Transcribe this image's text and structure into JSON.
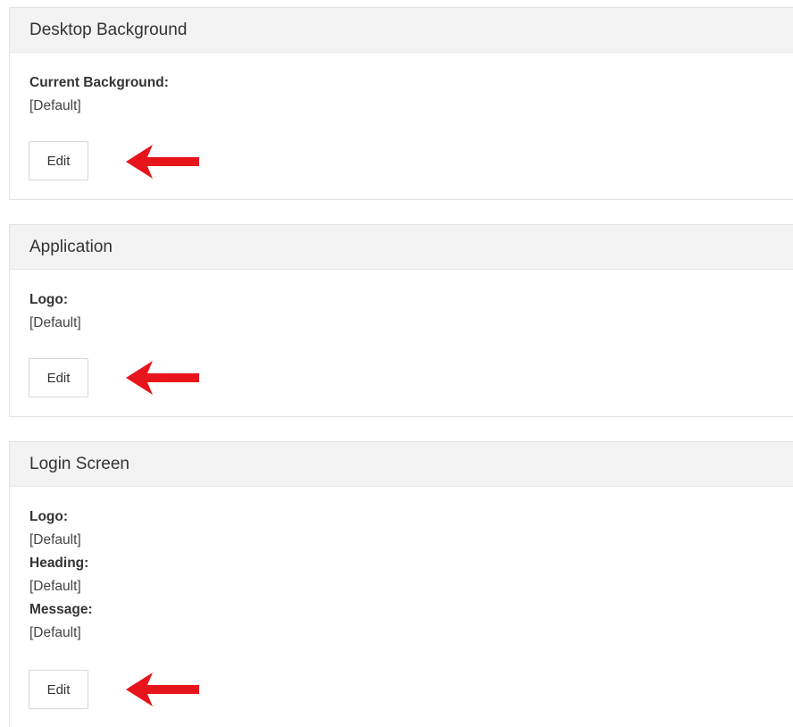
{
  "sections": [
    {
      "title": "Desktop Background",
      "fields": [
        {
          "label": "Current Background:",
          "value": "[Default]"
        }
      ],
      "edit_label": "Edit"
    },
    {
      "title": "Application",
      "fields": [
        {
          "label": "Logo:",
          "value": "[Default]"
        }
      ],
      "edit_label": "Edit"
    },
    {
      "title": "Login Screen",
      "fields": [
        {
          "label": "Logo:",
          "value": "[Default]"
        },
        {
          "label": "Heading:",
          "value": "[Default]"
        },
        {
          "label": "Message:",
          "value": "[Default]"
        }
      ],
      "edit_label": "Edit"
    }
  ],
  "colors": {
    "panel_header_bg": "#f3f3f3",
    "panel_border": "#e3e3e3",
    "arrow": "#e8141b"
  },
  "icons": {
    "annotation": "red-arrow-pointing-left-icon"
  }
}
